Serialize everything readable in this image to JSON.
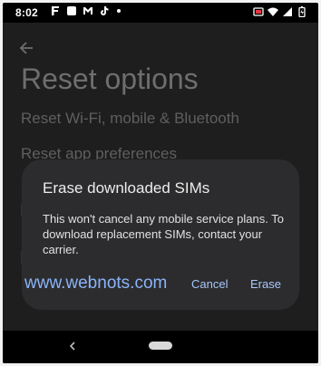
{
  "status_bar": {
    "time": "8:02",
    "left_icons": [
      "f-notification-icon",
      "square-notification-icon",
      "gmail-icon",
      "tiktok-icon"
    ],
    "right_icons": [
      "cast-icon",
      "wifi-icon",
      "signal-icon",
      "battery-icon"
    ]
  },
  "page": {
    "title": "Reset options",
    "options": [
      "Reset Wi-Fi, mobile & Bluetooth",
      "Reset app preferences"
    ]
  },
  "dialog": {
    "title": "Erase downloaded SIMs",
    "body": "This won't cancel any mobile service plans. To download replacement SIMs, contact your carrier.",
    "watermark": "www.webnots.com",
    "cancel_label": "Cancel",
    "erase_label": "Erase"
  },
  "colors": {
    "accent": "#a8c7fa",
    "dialog_bg": "#2c2c2e",
    "watermark": "#8ab4f8"
  }
}
